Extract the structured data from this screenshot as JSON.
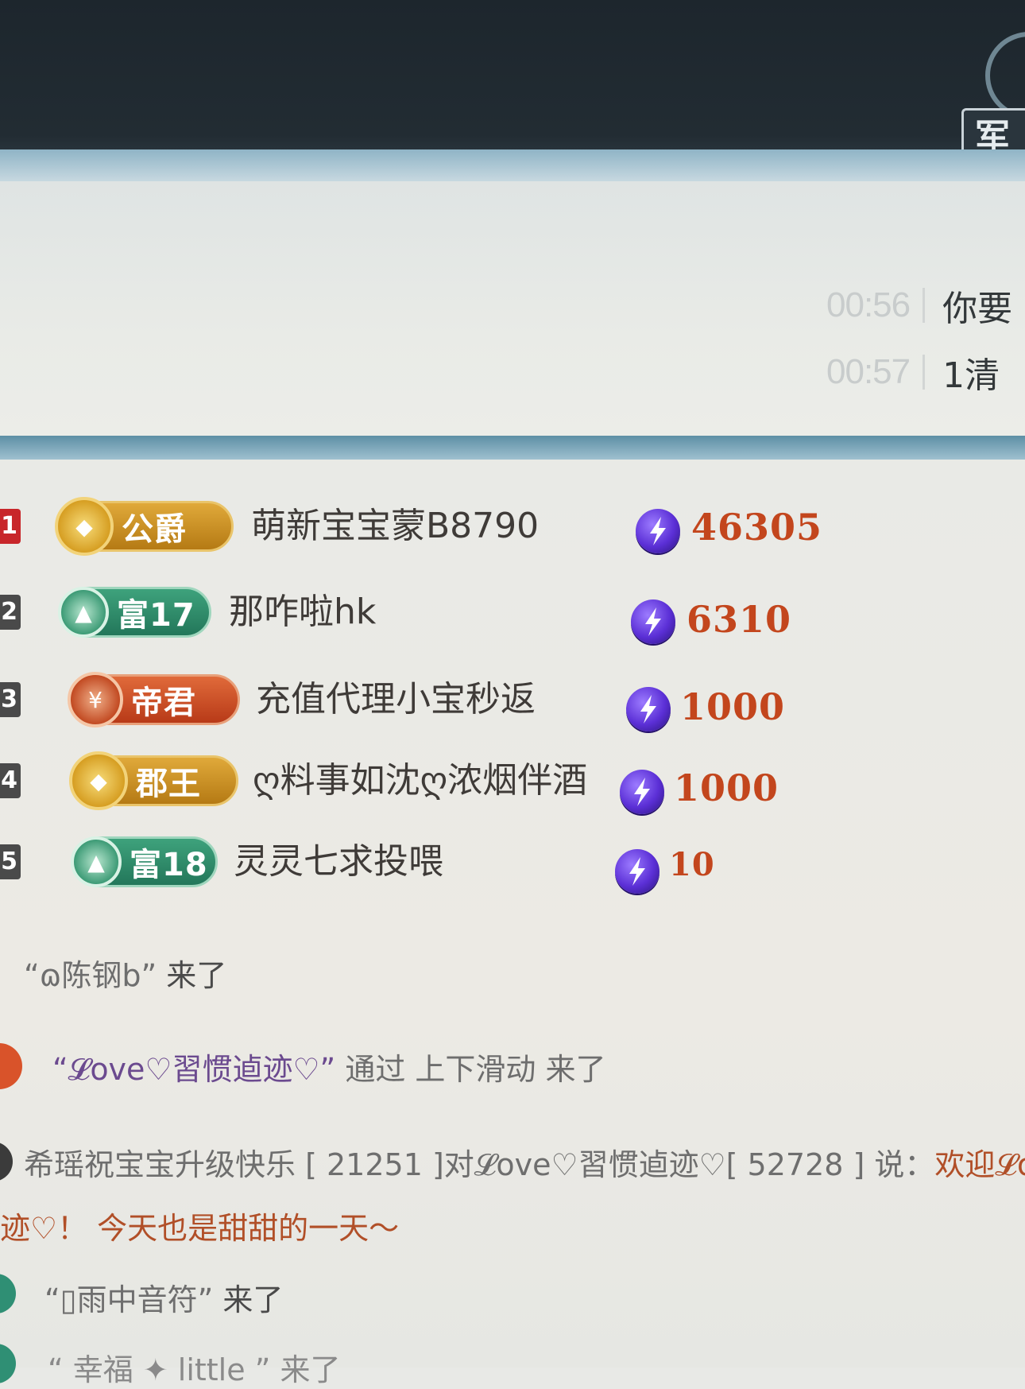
{
  "header": {
    "corner_label": "军"
  },
  "messages": [
    {
      "time": "00:56",
      "text": "你要"
    },
    {
      "time": "00:57",
      "text": "1清"
    }
  ],
  "leaderboard": [
    {
      "rank": "1",
      "badge": "公爵",
      "name": "萌新宝宝蒙B8790",
      "amount": "46305"
    },
    {
      "rank": "2",
      "badge": "富17",
      "name": "那咋啦hk",
      "amount": "6310"
    },
    {
      "rank": "3",
      "badge": "帝君",
      "name": "充值代理小宝秒返",
      "amount": "1000"
    },
    {
      "rank": "4",
      "badge": "郡王",
      "name": "ღ料事如沈ღ浓烟伴酒",
      "amount": "1000"
    },
    {
      "rank": "5",
      "badge": "富18",
      "name": "灵灵七求投喂",
      "amount": "10"
    }
  ],
  "chat": {
    "line1_user": "“ɷ陈钢b”",
    "line1_action": " 来了",
    "line2_user": "“𝓛ove♡習惯逌迹♡”",
    "line2_action": " 通过 上下滑动 来了",
    "line3_a": "希瑶祝宝宝升级快乐 [ 21251 ]对𝓛ove♡習惯逌迹♡[ 52728 ] 说：",
    "line3_b": "欢迎𝓛ov",
    "line3_c": "迹♡！ 今天也是甜甜的一天～",
    "line4_user": "“▯雨中音符”",
    "line4_action": " 来了",
    "line5_partial": "“ 幸福 ✦ little ” 来了"
  },
  "colors": {
    "gold_badge": "#c9921f",
    "green_badge": "#2e8b6a",
    "red_badge": "#c2431e",
    "amount": "#c3461d",
    "coin": "#5b2fd6"
  },
  "icons": {
    "coin": "purple-lightning-coin-icon"
  }
}
